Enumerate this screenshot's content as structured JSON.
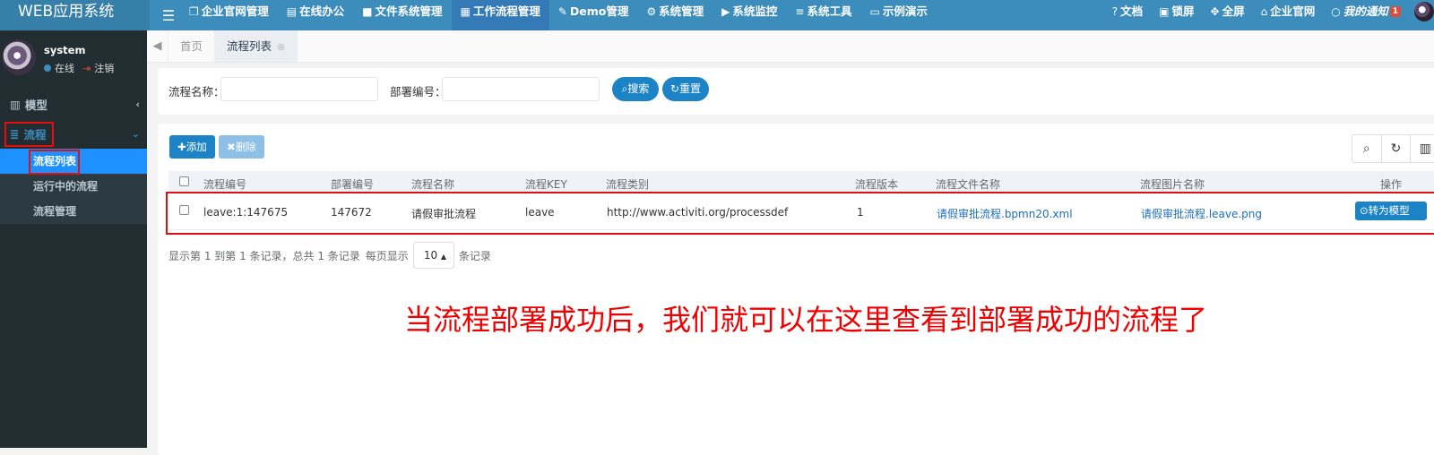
{
  "app": {
    "title": "WEB应用系统"
  },
  "topnav": {
    "menu_icon": "hamburger-icon",
    "items": [
      {
        "label": "企业官网管理",
        "icon": "copy-icon"
      },
      {
        "label": "在线办公",
        "icon": "id-card-icon"
      },
      {
        "label": "文件系统管理",
        "icon": "folder-icon"
      },
      {
        "label": "工作流程管理",
        "icon": "list-icon"
      },
      {
        "label": "Demo管理",
        "icon": "edit-icon"
      },
      {
        "label": "系统管理",
        "icon": "gear-icon"
      },
      {
        "label": "系统监控",
        "icon": "video-icon"
      },
      {
        "label": "系统工具",
        "icon": "bars-icon"
      },
      {
        "label": "示例演示",
        "icon": "desktop-icon"
      }
    ],
    "right": [
      {
        "label": "文档",
        "icon": "question-icon"
      },
      {
        "label": "锁屏",
        "icon": "lock-icon"
      },
      {
        "label": "全屏",
        "icon": "expand-icon"
      },
      {
        "label": "企业官网",
        "icon": "home-icon"
      }
    ],
    "notice": {
      "label": "我的通知",
      "count": "1",
      "icon": "comment-icon"
    }
  },
  "sidebar": {
    "user": {
      "name": "system",
      "status": "在线",
      "logout": "注销"
    },
    "menus": [
      {
        "label": "模型",
        "icon": "map-icon"
      },
      {
        "label": "流程",
        "icon": "database-icon"
      }
    ],
    "submenu": [
      {
        "label": "流程列表"
      },
      {
        "label": "运行中的流程"
      },
      {
        "label": "流程管理"
      }
    ]
  },
  "tabs": [
    {
      "label": "首页"
    },
    {
      "label": "流程列表"
    }
  ],
  "search": {
    "name_label": "流程名称：",
    "name_value": "",
    "deploy_label": "部署编号：",
    "deploy_value": "",
    "search_btn": "搜索",
    "reset_btn": "重置"
  },
  "toolbar": {
    "add": "添加",
    "delete": "删除"
  },
  "table": {
    "columns": [
      "流程编号",
      "部署编号",
      "流程名称",
      "流程KEY",
      "流程类别",
      "流程版本",
      "流程文件名称",
      "流程图片名称",
      "操作"
    ],
    "rows": [
      {
        "id": "leave:1:147675",
        "deploy_id": "147672",
        "name": "请假审批流程",
        "key": "leave",
        "category": "http://www.activiti.org/processdef",
        "version": "1",
        "file": "请假审批流程.bpmn20.xml",
        "image": "请假审批流程.leave.png",
        "action": "转为模型"
      }
    ]
  },
  "pager": {
    "summary": "显示第 1 到第 1 条记录，总共 1 条记录",
    "per_page_label": "每页显示",
    "per_page": "10",
    "suffix": "条记录"
  },
  "annotation": "当流程部署成功后，我们就可以在这里查看到部署成功的流程了"
}
